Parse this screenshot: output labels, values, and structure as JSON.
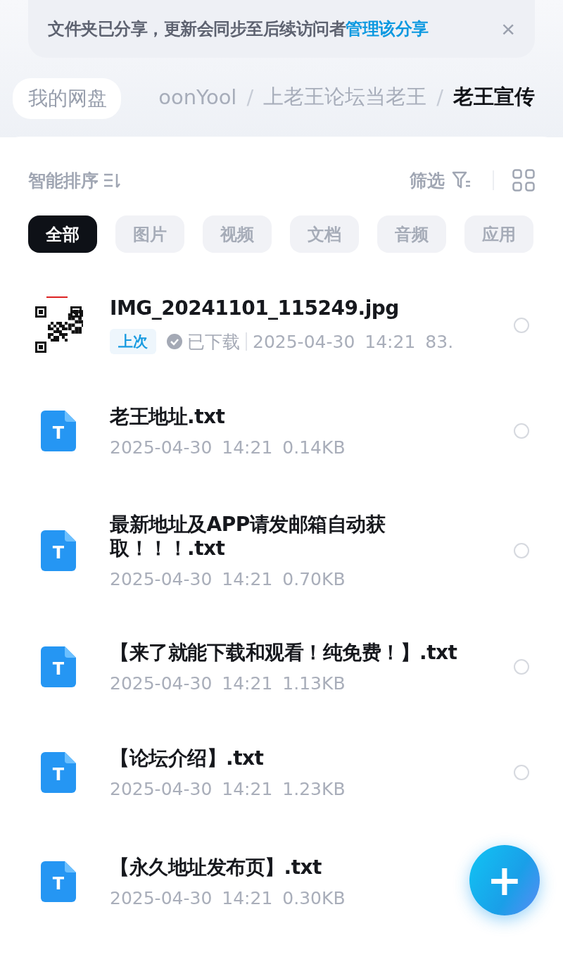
{
  "banner": {
    "message": "文件夹已分享，更新会同步至后续访问者",
    "link": "管理该分享",
    "close": "×"
  },
  "breadcrumb": {
    "root": "我的网盘",
    "items": [
      "oonYool",
      "上老王论坛当老王",
      "老王宣传"
    ],
    "separator": "/"
  },
  "toolbar": {
    "sort": "智能排序",
    "filter": "筛选"
  },
  "chips": [
    {
      "label": "全部",
      "selected": true
    },
    {
      "label": "图片",
      "selected": false
    },
    {
      "label": "视频",
      "selected": false
    },
    {
      "label": "文档",
      "selected": false
    },
    {
      "label": "音频",
      "selected": false
    },
    {
      "label": "应用",
      "selected": false
    }
  ],
  "files": [
    {
      "name": "IMG_20241101_115249.jpg",
      "tag": "上次",
      "status": "已下载",
      "date": "2025-04-30",
      "time": "14:21",
      "size": "83.",
      "selected": false
    },
    {
      "kind": "text",
      "icon_letter": "T",
      "name": "老王地址.txt",
      "date": "2025-04-30",
      "time": "14:21",
      "size": "0.14KB",
      "selected": false
    },
    {
      "kind": "text",
      "icon_letter": "T",
      "name": "最新地址及APP请发邮箱自动获取！！！.txt",
      "date": "2025-04-30",
      "time": "14:21",
      "size": "0.70KB",
      "selected": false
    },
    {
      "kind": "text",
      "icon_letter": "T",
      "name": "【来了就能下载和观看！纯免费！】.txt",
      "date": "2025-04-30",
      "time": "14:21",
      "size": "1.13KB",
      "selected": false
    },
    {
      "kind": "text",
      "icon_letter": "T",
      "name": "【论坛介绍】.txt",
      "date": "2025-04-30",
      "time": "14:21",
      "size": "1.23KB",
      "selected": false
    },
    {
      "kind": "text",
      "icon_letter": "T",
      "name": "【永久地址发布页】.txt",
      "date": "2025-04-30",
      "time": "14:21",
      "size": "0.30KB"
    }
  ],
  "fab": {
    "label": "+"
  }
}
